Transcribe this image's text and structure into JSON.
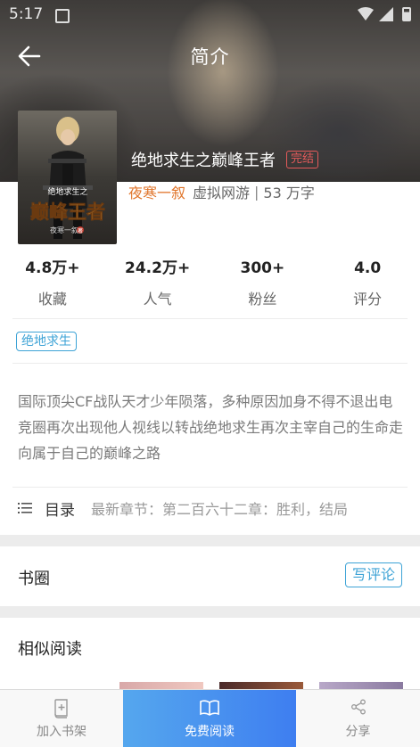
{
  "status_bar": {
    "time": "5:17"
  },
  "header": {
    "title": "简介",
    "back_icon": "arrow-left-icon"
  },
  "book": {
    "title": "绝地求生之巅峰王者",
    "status": "完结",
    "author": "夜寒一叙",
    "genre": "虚拟网游",
    "separator": "|",
    "words": "53 万字",
    "cover_text": {
      "series": "绝地求生之",
      "title": "巅峰王者",
      "author": "夜寒一叙",
      "badge": "著"
    }
  },
  "stats": [
    {
      "value": "4.8万+",
      "label": "收藏"
    },
    {
      "value": "24.2万+",
      "label": "人气"
    },
    {
      "value": "300+",
      "label": "粉丝"
    },
    {
      "value": "4.0",
      "label": "评分"
    }
  ],
  "tag": "绝地求生",
  "description": "国际顶尖CF战队天才少年陨落，多种原因加身不得不退出电竞圈再次出现他人视线以转战绝地求生再次主宰自己的生命走向属于自己的巅峰之路",
  "catalog": {
    "label": "目录",
    "latest": "最新章节：第二百六十二章：胜利，结局"
  },
  "book_circle": {
    "title": "书圈",
    "write_review": "写评论"
  },
  "similar": {
    "title": "相似阅读"
  },
  "bottom_bar": {
    "add_shelf": "加入书架",
    "free_read": "免费阅读",
    "share": "分享"
  },
  "colors": {
    "accent_blue": "#3da3d6",
    "author_orange": "#e0752b",
    "status_red": "#e55a5a",
    "read_button_start": "#55a7ee",
    "read_button_end": "#3e7ef0"
  }
}
